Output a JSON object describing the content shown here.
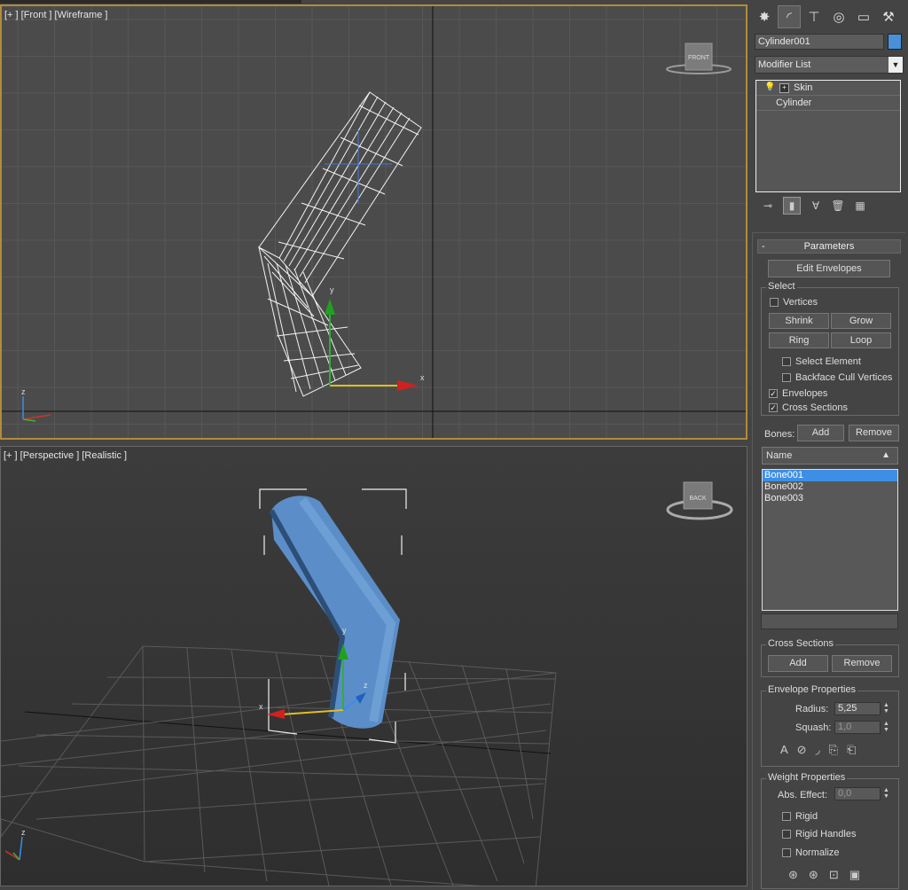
{
  "viewports": {
    "front": {
      "label": "[+ ] [Front ] [Wireframe ]",
      "cube_label": "FRONT"
    },
    "perspective": {
      "label": "[+ ] [Perspective ] [Realistic ]",
      "cube_label": "BACK"
    }
  },
  "axes": {
    "x": "x",
    "y": "y",
    "z": "z"
  },
  "panel": {
    "object_name": "Cylinder001",
    "object_color": "#4a90d9",
    "modifier_list": "Modifier List",
    "stack": [
      {
        "label": "Skin"
      },
      {
        "label": "Cylinder"
      }
    ],
    "parameters_header": "Parameters",
    "collapse_sign": "-",
    "edit_envelopes": "Edit Envelopes",
    "select": {
      "title": "Select",
      "vertices": "Vertices",
      "shrink": "Shrink",
      "grow": "Grow",
      "ring": "Ring",
      "loop": "Loop",
      "select_element": "Select Element",
      "backface_cull": "Backface Cull Vertices",
      "envelopes": "Envelopes",
      "cross_sections": "Cross Sections"
    },
    "bones": {
      "label": "Bones:",
      "add": "Add",
      "remove": "Remove",
      "column": "Name",
      "items": [
        "Bone001",
        "Bone002",
        "Bone003"
      ]
    },
    "cross_sections": {
      "title": "Cross Sections",
      "add": "Add",
      "remove": "Remove"
    },
    "envelope_properties": {
      "title": "Envelope Properties",
      "radius_label": "Radius:",
      "radius": "5,25",
      "squash_label": "Squash:",
      "squash": "1,0"
    },
    "weight_properties": {
      "title": "Weight Properties",
      "abs_effect_label": "Abs. Effect:",
      "abs_effect": "0,0",
      "rigid": "Rigid",
      "rigid_handles": "Rigid Handles",
      "normalize": "Normalize"
    }
  }
}
